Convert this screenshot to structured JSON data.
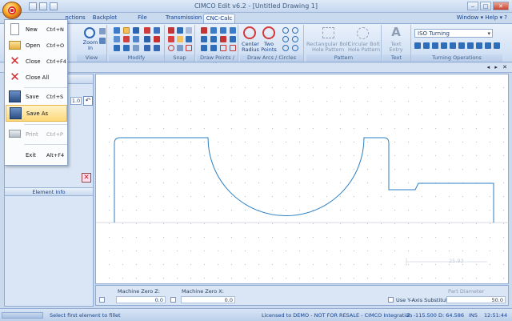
{
  "title_bar": {
    "title": "CIMCO Edit v6.2 - [Untitled Drawing 1]"
  },
  "tabs": [
    {
      "label": "nctions"
    },
    {
      "label": "Backplot"
    },
    {
      "label": "File Compare"
    },
    {
      "label": "Transmission"
    },
    {
      "label": "CNC-Calc",
      "active": true
    }
  ],
  "tab_right": {
    "window": "Window",
    "help": "Help"
  },
  "ribbon": {
    "groups": [
      {
        "label": "View",
        "big_button": "Zoom\nIn"
      },
      {
        "label": "Modify"
      },
      {
        "label": "Snap"
      },
      {
        "label": "Draw Points / Li..."
      },
      {
        "label": "Draw Arcs / Circles",
        "buttons": [
          "Center\nRadius",
          "Two\nPoints"
        ]
      },
      {
        "label": "Pattern",
        "buttons": [
          "Rectangular Bolt\nHole Pattern",
          "Circular Bolt\nHole Pattern"
        ]
      },
      {
        "label": "Text",
        "buttons": [
          "Text\nEntry"
        ]
      },
      {
        "label": "Turning Operations",
        "combo": "ISO Turning"
      }
    ]
  },
  "left_panel": {
    "value": "1.0",
    "element_info": "Element Info"
  },
  "file_menu": {
    "items": [
      {
        "label": "New",
        "shortcut": "Ctrl+N",
        "icon": "new-file-icon"
      },
      {
        "label": "Open",
        "shortcut": "Ctrl+O",
        "icon": "open-folder-icon"
      },
      {
        "label": "Close",
        "shortcut": "Ctrl+F4",
        "icon": "close-x-icon"
      },
      {
        "label": "Close All",
        "shortcut": "",
        "icon": "close-all-icon"
      },
      {
        "label": "Save",
        "shortcut": "Ctrl+S",
        "icon": "save-icon"
      },
      {
        "label": "Save As",
        "shortcut": "",
        "icon": "save-as-icon",
        "selected": true
      },
      {
        "label": "Print",
        "shortcut": "Ctrl+P",
        "icon": "print-icon",
        "disabled": true
      },
      {
        "label": "Exit",
        "shortcut": "Alt+F4",
        "icon": ""
      }
    ]
  },
  "canvas": {
    "dimension_label": "25.93"
  },
  "bottom": {
    "machine_zero_z_label": "Machine Zero Z:",
    "machine_zero_z_value": "0.0",
    "machine_zero_x_label": "Machine Zero X:",
    "machine_zero_x_value": "0.0",
    "y_axis_label": "Use Y-Axis Substitution",
    "part_diameter_label": "Part Diameter",
    "part_diameter_value": "50.0"
  },
  "status_bar": {
    "message": "Select first element to fillet",
    "license": "Licensed to DEMO - NOT FOR RESALE - CIMCO Integration",
    "coords": "Z: -115.500  D: 64.586",
    "ins": "INS",
    "time": "12:51:44"
  },
  "colors": {
    "accent": "#15428b",
    "profile": "#2b7fc4",
    "selection": "#fed87a"
  }
}
